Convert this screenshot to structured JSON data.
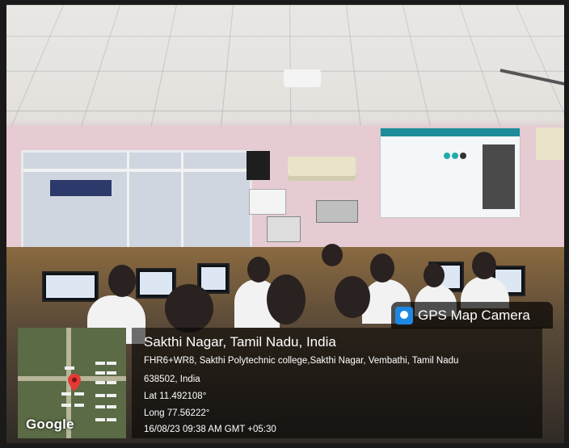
{
  "photo": {
    "description_free": true
  },
  "badge": {
    "app_name": "GPS Map Camera",
    "icon": "gps-map-camera-app-icon"
  },
  "location": {
    "title": "Sakthi Nagar, Tamil Nadu, India",
    "address_line1": "FHR6+WR8, Sakthi Polytechnic college,Sakthi Nagar, Vembathi, Tamil Nadu",
    "address_line2": "638502, India",
    "lat": "Lat 11.492108°",
    "long": "Long 77.56222°",
    "timestamp": "16/08/23 09:38 AM GMT +05:30"
  },
  "map": {
    "logo_text": "Google",
    "pin_icon": "location-pin-icon",
    "pin_color": "#e53935"
  }
}
